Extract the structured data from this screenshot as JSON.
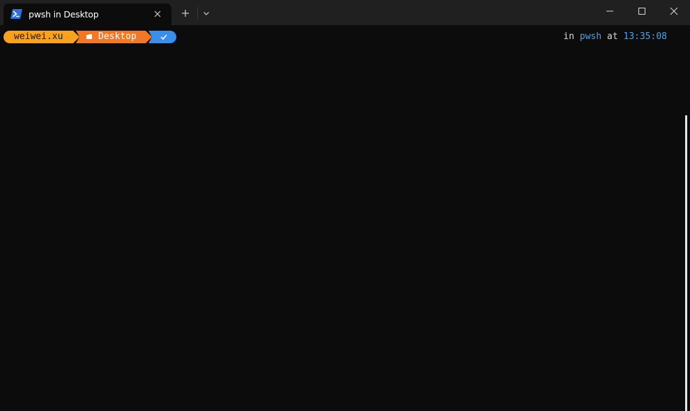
{
  "window": {
    "tab_title": "pwsh in Desktop",
    "icons": {
      "tab": "powershell-icon",
      "close_tab": "close-icon",
      "new_tab": "plus-icon",
      "dropdown": "chevron-down-icon",
      "minimize": "minimize-icon",
      "maximize": "maximize-icon",
      "close": "close-icon"
    }
  },
  "prompt": {
    "user": "weiwei.xu",
    "directory": "Desktop",
    "directory_icon": "folder-icon",
    "status_icon": "check-icon",
    "right": {
      "in_label": "in",
      "shell": "pwsh",
      "at_label": "at",
      "time": "13:35:08"
    }
  },
  "colors": {
    "user_segment": "#f8a21f",
    "dir_segment": "#f07826",
    "status_segment": "#3b8eea",
    "accent_text": "#4aa3f0",
    "background": "#0c0c0c",
    "titlebar": "#202020"
  }
}
